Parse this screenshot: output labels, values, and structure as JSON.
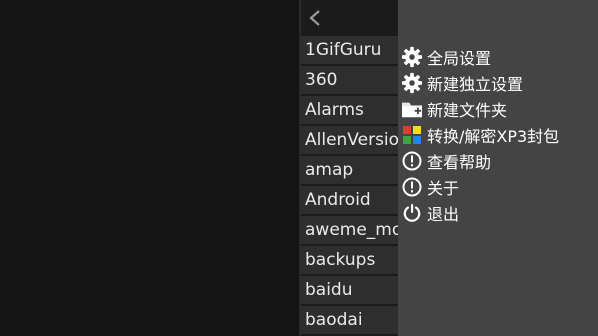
{
  "file_panel": {
    "back_icon": "chevron-left-icon",
    "items": [
      {
        "label": "1GifGuru"
      },
      {
        "label": "360"
      },
      {
        "label": "Alarms"
      },
      {
        "label": "AllenVersion"
      },
      {
        "label": "amap"
      },
      {
        "label": "Android"
      },
      {
        "label": "aweme_monitor"
      },
      {
        "label": "backups"
      },
      {
        "label": "baidu"
      },
      {
        "label": "baodai"
      }
    ]
  },
  "menu": {
    "items": [
      {
        "label": "全局设置",
        "icon": "gear-icon"
      },
      {
        "label": "新建独立设置",
        "icon": "gear-icon"
      },
      {
        "label": "新建文件夹",
        "icon": "new-folder-icon"
      },
      {
        "label": "转换/解密XP3封包",
        "icon": "colored-blocks-icon"
      },
      {
        "label": "查看帮助",
        "icon": "info-circle-icon"
      },
      {
        "label": "关于",
        "icon": "info-circle-icon"
      },
      {
        "label": "退出",
        "icon": "power-icon"
      }
    ]
  },
  "colors": {
    "background": "#151515",
    "file_item_bg": "#2e2e2e",
    "menu_bg": "#444444"
  }
}
